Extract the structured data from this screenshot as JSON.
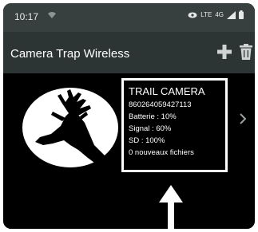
{
  "status_bar": {
    "time": "10:17",
    "icons": [
      "wifi-icon",
      "eye-icon",
      "lte-icon",
      "4g-icon",
      "signal-icon",
      "battery-icon"
    ],
    "lte_label": "LTE",
    "network_label": "4G"
  },
  "app_bar": {
    "title": "Camera Trap Wireless",
    "actions": [
      "add-icon",
      "trash-icon"
    ]
  },
  "camera": {
    "name": "TRAIL CAMERA",
    "id": "860264059427113",
    "battery": "Batterie : 10%",
    "signal": "Signal : 60%",
    "sd": "SD : 100%",
    "new_files": "0 nouveaux fichiers"
  },
  "colors": {
    "status_bar": "#37403f",
    "app_bar": "#2d3534",
    "background": "#000000",
    "text": "#ffffff"
  }
}
